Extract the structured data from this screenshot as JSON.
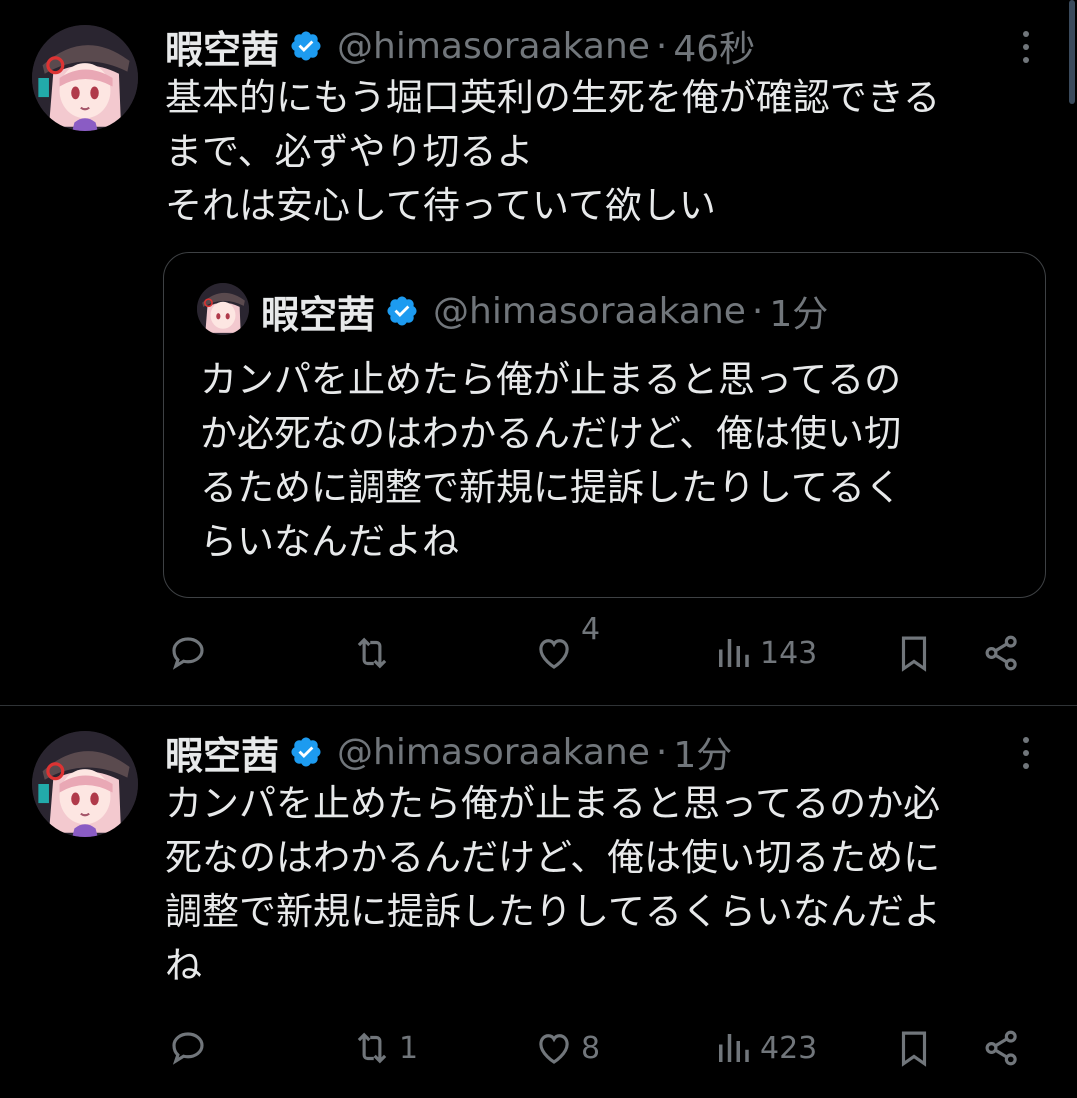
{
  "colors": {
    "background": "#000000",
    "text": "#e7e9ea",
    "muted": "#71767b",
    "verified": "#1d9bf0",
    "border": "#2f3336"
  },
  "tweets": [
    {
      "name": "暇空茜",
      "handle": "@himasoraakane",
      "separator": "·",
      "time": "46秒",
      "body": [
        "基本的にもう堀口英利の生死を俺が確認できる",
        "まで、必ずやり切るよ",
        "それは安心して待っていて欲しい"
      ],
      "quote": {
        "name": "暇空茜",
        "handle": "@himasoraakane",
        "separator": "·",
        "time": "1分",
        "body": [
          "カンパを止めたら俺が止まると思ってるの",
          "か必死なのはわかるんだけど、俺は使い切",
          "るために調整で新規に提訴したりしてるく",
          "らいなんだよね"
        ]
      },
      "actions": {
        "replies": "",
        "reposts": "",
        "likes": "4",
        "views": "143"
      }
    },
    {
      "name": "暇空茜",
      "handle": "@himasoraakane",
      "separator": "·",
      "time": "1分",
      "body": [
        "カンパを止めたら俺が止まると思ってるのか必",
        "死なのはわかるんだけど、俺は使い切るために",
        "調整で新規に提訴したりしてるくらいなんだよ",
        "ね"
      ],
      "actions": {
        "replies": "",
        "reposts": "1",
        "likes": "8",
        "views": "423"
      }
    }
  ],
  "icons": {
    "avatar": "avatar-image",
    "verified": "verified-badge-icon",
    "more": "more-options-icon",
    "reply": "reply-icon",
    "repost": "repost-icon",
    "like": "heart-icon",
    "views": "analytics-icon",
    "bookmark": "bookmark-icon",
    "share": "share-icon"
  }
}
